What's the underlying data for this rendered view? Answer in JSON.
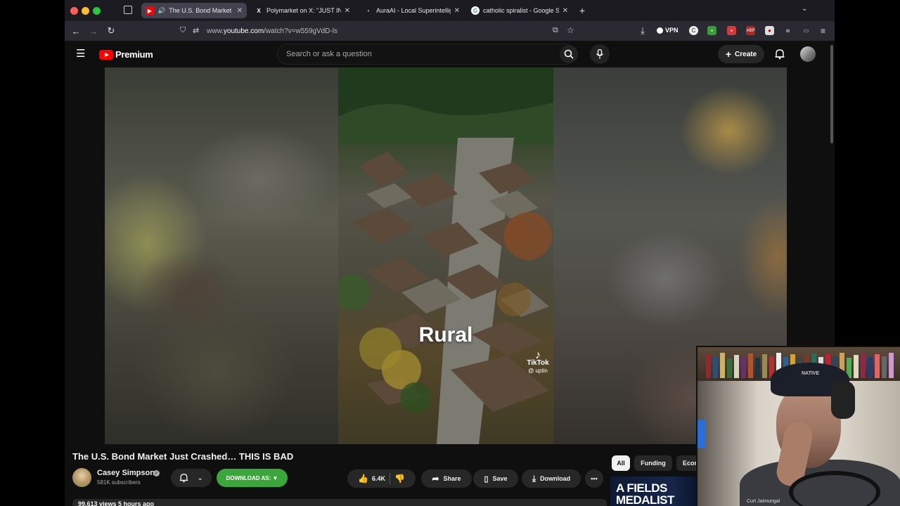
{
  "browser": {
    "tabs": [
      {
        "title": "The U.S. Bond Market Just",
        "icon": "youtube-icon",
        "active": true
      },
      {
        "title": "Polymarket on X: \"JUST IN: It's",
        "icon": "x-logo-icon",
        "active": false
      },
      {
        "title": "AuraAI - Local Superintelligence",
        "icon": "aura-icon",
        "active": false
      },
      {
        "title": "catholic spiralist - Google Search",
        "icon": "google-icon",
        "active": false
      }
    ],
    "url_prefix": "www.",
    "url_host": "youtube.com",
    "url_path": "/watch?v=w559gVdD-ls",
    "vpn_label": "VPN"
  },
  "youtube": {
    "logo_text": "Premium",
    "search_placeholder": "Search or ask a question",
    "create_label": "Create"
  },
  "video": {
    "overlay_text": "Rural",
    "tiktok_label": "TikTok",
    "tiktok_handle": "@ uptin",
    "title": "The U.S. Bond Market Just Crashed… THIS IS BAD",
    "channel_name": "Casey Simpson",
    "subscribers": "581K subscribers",
    "download_as_label": "DOWNLOAD AS: ▼",
    "likes": "6.4K",
    "share_label": "Share",
    "save_label": "Save",
    "download_label": "Download",
    "views_line": "99,613 views  5 hours ago"
  },
  "chips": [
    "All",
    "Funding",
    "Econ"
  ],
  "recommendation": {
    "thumb_text": "A FIELDS MEDALIST",
    "channel": "Curt Jaimungal"
  },
  "webcam": {
    "cap_text": "NATIVE"
  },
  "colors": {
    "youtube_red": "#ff0000",
    "download_green": "#3ba63a",
    "page_bg": "#0f0f0f"
  }
}
